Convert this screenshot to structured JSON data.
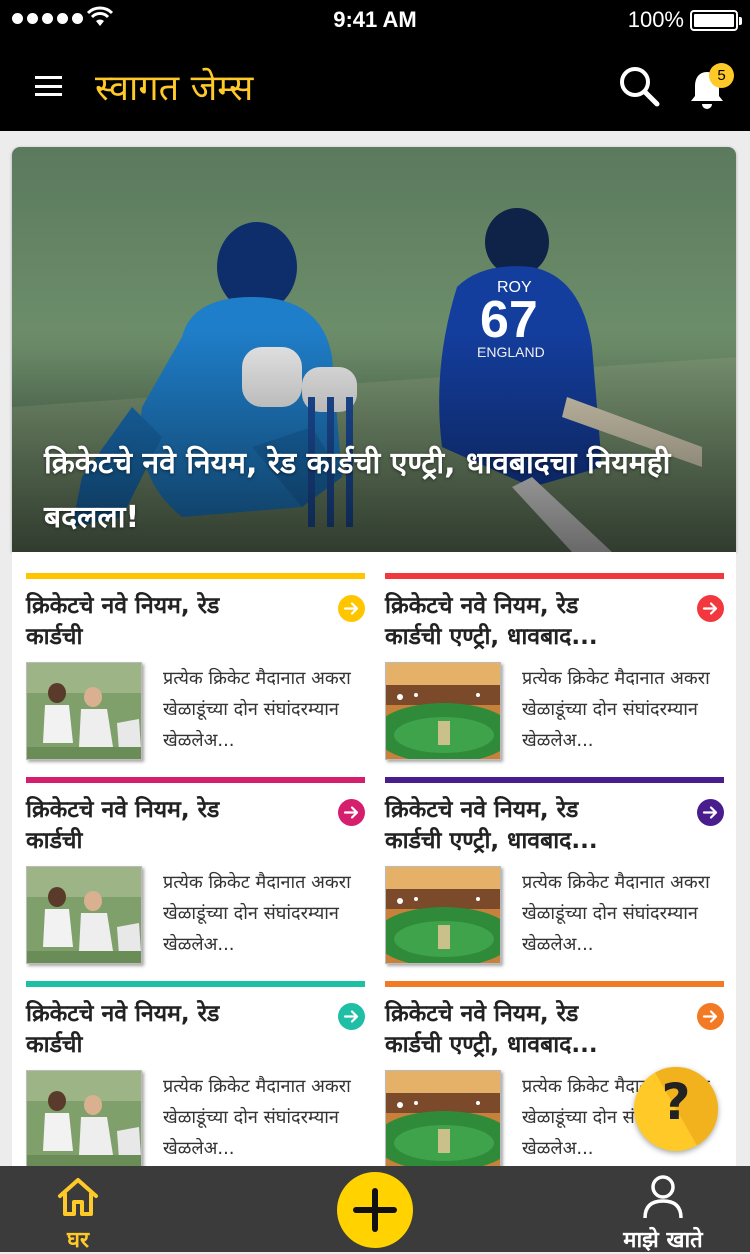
{
  "status_bar": {
    "time": "9:41 AM",
    "battery": "100%"
  },
  "header": {
    "title": "स्वागत जेम्स",
    "notification_count": "5"
  },
  "hero": {
    "headline": "क्रिकेटचे नवे नियम, रेड कार्डची एण्ट्री, धावबादचा नियमही बदलला!"
  },
  "cards": [
    {
      "title": "क्रिकेटचे नवे नियम, रेड\nकार्डची",
      "desc": "प्रत्येक क्रिकेट मैदानात अकरा खेळाडूंच्या दोन संघांदरम्यान खेळलेअ...",
      "color": "#ffc600"
    },
    {
      "title": "क्रिकेटचे नवे नियम, रेड\nकार्डची एण्ट्री, धावबाद...",
      "desc": "प्रत्येक क्रिकेट मैदानात अकरा खेळाडूंच्या दोन संघांदरम्यान खेळलेअ...",
      "color": "#f2373f"
    },
    {
      "title": "क्रिकेटचे नवे नियम, रेड\nकार्डची",
      "desc": "प्रत्येक क्रिकेट मैदानात अकरा खेळाडूंच्या दोन संघांदरम्यान खेळलेअ...",
      "color": "#d61e6e"
    },
    {
      "title": "क्रिकेटचे नवे नियम, रेड\nकार्डची एण्ट्री, धावबाद...",
      "desc": "प्रत्येक क्रिकेट मैदानात अकरा खेळाडूंच्या दोन संघांदरम्यान खेळलेअ...",
      "color": "#4a1d8f"
    },
    {
      "title": "क्रिकेटचे नवे नियम, रेड\nकार्डची",
      "desc": "प्रत्येक क्रिकेट मैदानात अकरा खेळाडूंच्या दोन संघांदरम्यान खेळलेअ...",
      "color": "#1fbfa6"
    },
    {
      "title": "क्रिकेटचे नवे नियम, रेड\nकार्डची एण्ट्री, धावबाद...",
      "desc": "प्रत्येक क्रिकेट मैदानात अकरा खेळाडूंच्या दोन संघांदरम्यान खेळलेअ...",
      "color": "#f27a24"
    }
  ],
  "help_button": {
    "label": "?"
  },
  "bottom_nav": {
    "home_label": "घर",
    "account_label": "माझे खाते"
  },
  "colors": {
    "accent": "#ffc928",
    "header_bg": "#000000",
    "nav_bg": "#3b3b3b"
  }
}
